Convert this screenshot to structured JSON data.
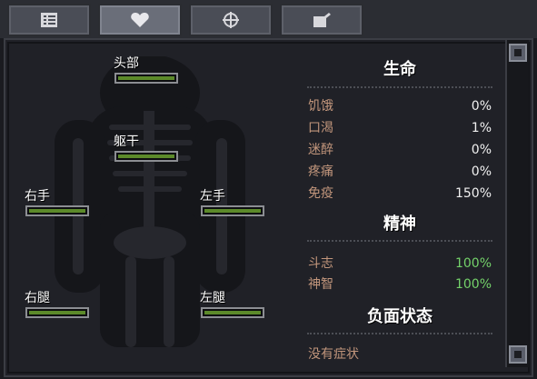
{
  "tabs": [
    {
      "icon": "list-icon",
      "active": false
    },
    {
      "icon": "heart-icon",
      "active": true
    },
    {
      "icon": "crosshair-icon",
      "active": false
    },
    {
      "icon": "note-icon",
      "active": false
    }
  ],
  "body_parts": [
    {
      "label": "头部",
      "health": 1.0
    },
    {
      "label": "躯干",
      "health": 1.0
    },
    {
      "label": "右手",
      "health": 1.0
    },
    {
      "label": "左手",
      "health": 1.0
    },
    {
      "label": "右腿",
      "health": 1.0
    },
    {
      "label": "左腿",
      "health": 1.0
    }
  ],
  "sections": {
    "life": {
      "title": "生命",
      "stats": [
        {
          "label": "饥饿",
          "value": "0%"
        },
        {
          "label": "口渴",
          "value": "1%"
        },
        {
          "label": "迷醉",
          "value": "0%"
        },
        {
          "label": "疼痛",
          "value": "0%"
        },
        {
          "label": "免疫",
          "value": "150%"
        }
      ]
    },
    "mind": {
      "title": "精神",
      "stats": [
        {
          "label": "斗志",
          "value": "100%"
        },
        {
          "label": "神智",
          "value": "100%"
        }
      ]
    },
    "negative": {
      "title": "负面状态",
      "empty_text": "没有症状"
    }
  },
  "colors": {
    "bar_fill": "#5c8a2a",
    "good_value": "#74d26a",
    "stat_label": "#c2967c"
  }
}
